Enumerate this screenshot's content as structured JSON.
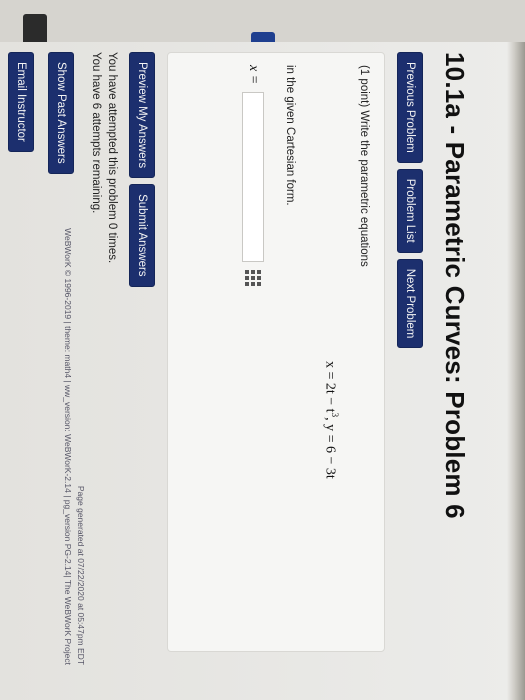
{
  "page": {
    "title": "10.1a - Parametric Curves: Problem 6"
  },
  "nav": {
    "previous": "Previous Problem",
    "list": "Problem List",
    "next": "Next Problem"
  },
  "problem": {
    "prompt": "(1 point) Write the parametric equations",
    "equation": {
      "x_label": "x = 2t − t",
      "x_exp": "3",
      "y_part": ",   y = 6 − 3t"
    },
    "subprompt": "in the given Cartesian form.",
    "answer_label": "x =",
    "answer_value": "",
    "answer_placeholder": ""
  },
  "actions": {
    "preview": "Preview My Answers",
    "submit": "Submit Answers"
  },
  "status": {
    "attempted": "You have attempted this problem 0 times.",
    "remaining": "You have 6 attempts remaining."
  },
  "extra": {
    "show_past": "Show Past Answers",
    "email": "Email Instructor"
  },
  "footer": {
    "generated": "Page generated at 07/22/2020 at 05:47pm EDT",
    "credits": "WeBWorK © 1996-2019 | theme: math4 | ww_version: WeBWorK-2.14 | pg_version PG-2.14| The WeBWorK Project"
  }
}
